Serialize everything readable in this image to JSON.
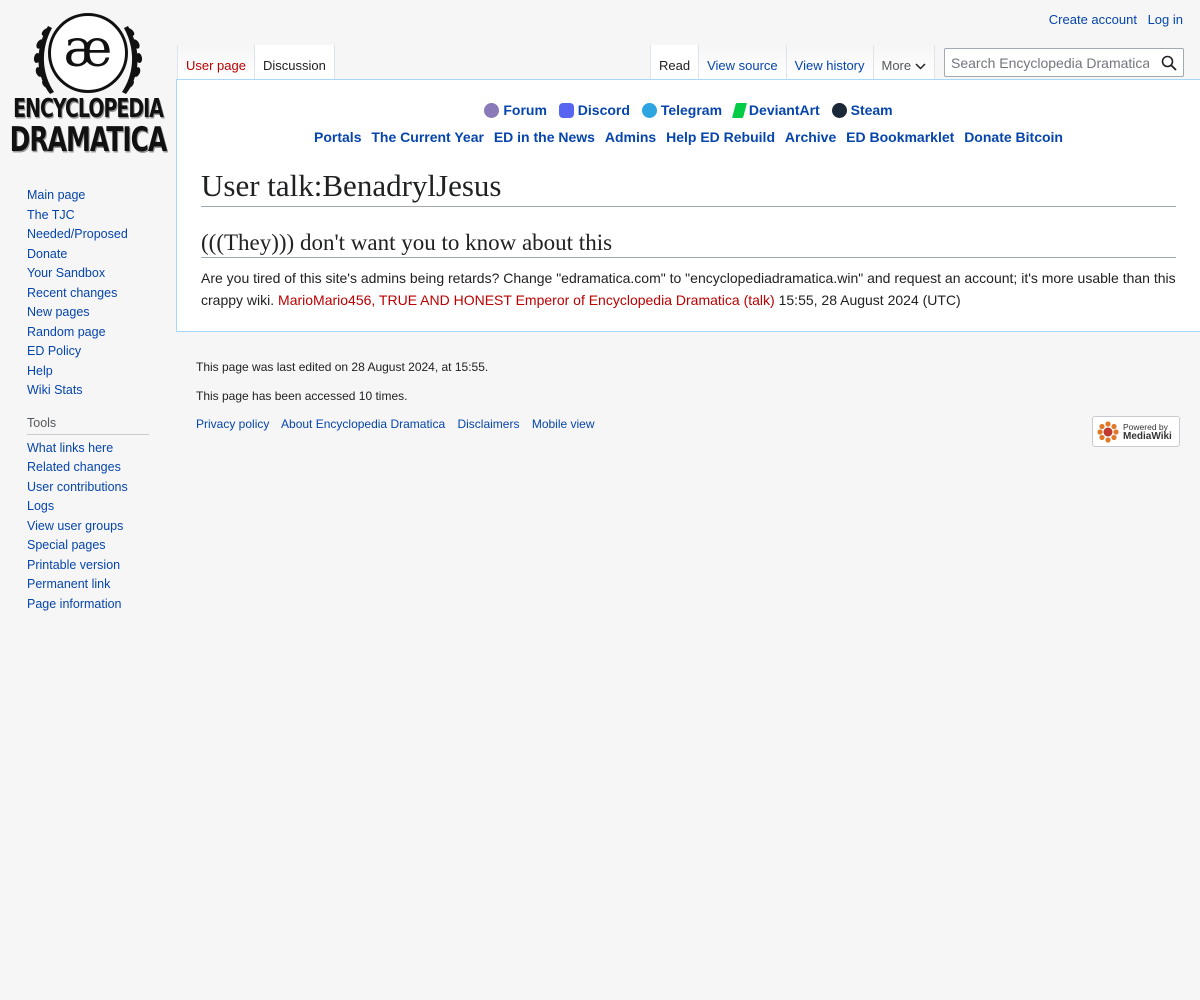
{
  "logo": {
    "glyph": "æ",
    "line1": "ENCYCLOPEDIA",
    "line2": "DRAMATICA"
  },
  "personal": {
    "create_account": "Create account",
    "login": "Log in"
  },
  "tabs_left": [
    {
      "label": "User page",
      "state": "new"
    },
    {
      "label": "Discussion",
      "state": "selected"
    }
  ],
  "tabs_right": [
    {
      "label": "Read",
      "state": "selected"
    },
    {
      "label": "View source"
    },
    {
      "label": "View history"
    }
  ],
  "more": {
    "label": "More"
  },
  "search": {
    "placeholder": "Search Encyclopedia Dramatica"
  },
  "site_links": [
    {
      "label": "Forum",
      "icon": "forum-icon",
      "color": "#8a7ab8"
    },
    {
      "label": "Discord",
      "icon": "discord-icon",
      "color": "#5865f2"
    },
    {
      "label": "Telegram",
      "icon": "telegram-icon",
      "color": "#2ca5e0"
    },
    {
      "label": "DeviantArt",
      "icon": "deviantart-icon",
      "color": "#05cc47"
    },
    {
      "label": "Steam",
      "icon": "steam-icon",
      "color": "#1b2838"
    }
  ],
  "portal_links": [
    "Portals",
    "The Current Year",
    "ED in the News",
    "Admins",
    "Help ED Rebuild",
    "Archive",
    "ED Bookmarklet",
    "Donate Bitcoin"
  ],
  "page": {
    "title": "User talk:BenadrylJesus",
    "section_heading": "(((They))) don't want you to know about this",
    "body_text": "Are you tired of this site's admins being retards? Change \"edramatica.com\" to \"encyclopediadramatica.win\" and request an account; it's more usable than this crappy wiki. ",
    "signature_user": "MarioMario456, TRUE AND HONEST Emperor of Encyclopedia Dramatica",
    "signature_open": " (",
    "signature_talk": "talk",
    "signature_close": ")",
    "signature_time": " 15:55, 28 August 2024 (UTC)"
  },
  "sidebar": {
    "nav": [
      "Main page",
      "The TJC",
      "Needed/Proposed",
      "Donate",
      "Your Sandbox",
      "Recent changes",
      "New pages",
      "Random page",
      "ED Policy",
      "Help",
      "Wiki Stats"
    ],
    "tools_heading": "Tools",
    "tools": [
      "What links here",
      "Related changes",
      "User contributions",
      "Logs",
      "View user groups",
      "Special pages",
      "Printable version",
      "Permanent link",
      "Page information"
    ]
  },
  "footer": {
    "last_edited": "This page was last edited on 28 August 2024, at 15:55.",
    "accessed": "This page has been accessed 10 times.",
    "links": [
      "Privacy policy",
      "About Encyclopedia Dramatica",
      "Disclaimers",
      "Mobile view"
    ],
    "powered_line1": "Powered by",
    "powered_line2": "MediaWiki"
  }
}
